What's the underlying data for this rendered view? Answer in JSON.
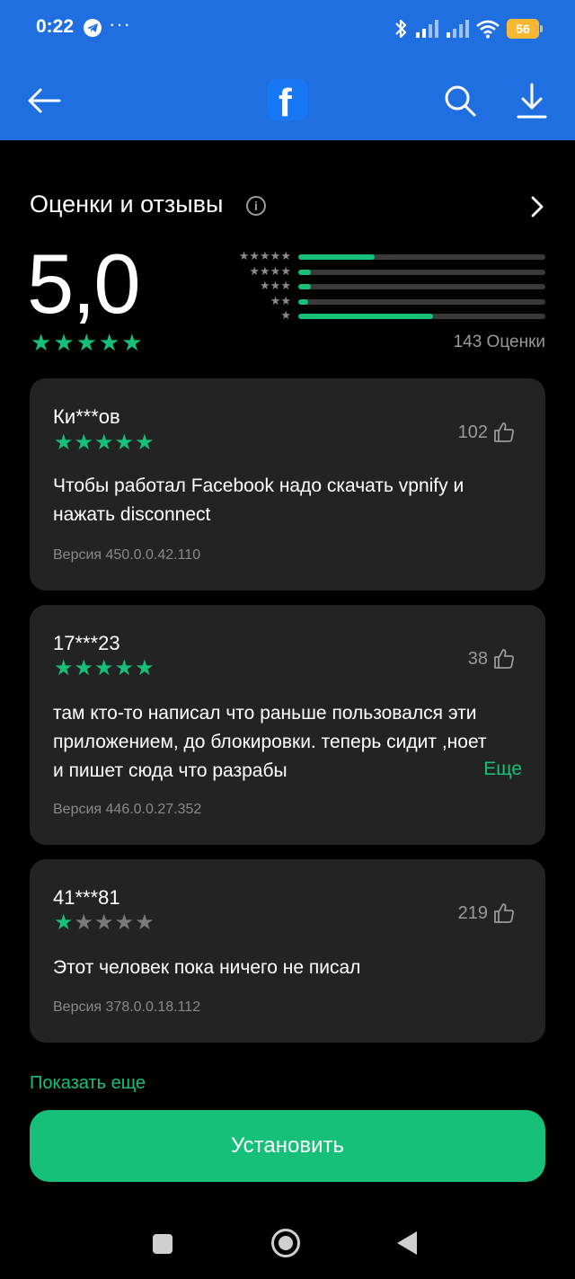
{
  "status_bar": {
    "time": "0:22",
    "more": "···",
    "battery": "56",
    "icons": [
      "telegram-icon",
      "bluetooth-icon",
      "signal-icon",
      "signal-icon",
      "wifi-icon",
      "battery-icon"
    ]
  },
  "app_bar": {
    "logo_letter": "f",
    "icons": [
      "back-arrow-icon",
      "facebook-logo",
      "search-icon",
      "download-icon"
    ],
    "colors": {
      "background": "#1f6fe0",
      "logo": "#1877f2"
    }
  },
  "ratings": {
    "title": "Оценки и отзывы",
    "info_symbol": "i",
    "score": "5,0",
    "stars": 5,
    "count_label": "143 Оценки",
    "distribution": [
      {
        "stars": 5,
        "fraction": 0.31
      },
      {
        "stars": 4,
        "fraction": 0.05
      },
      {
        "stars": 3,
        "fraction": 0.05
      },
      {
        "stars": 2,
        "fraction": 0.04
      },
      {
        "stars": 1,
        "fraction": 0.545
      }
    ]
  },
  "reviews": [
    {
      "author": "Ки***ов",
      "rating": 5,
      "likes": "102",
      "text": "Чтобы работал Facebook надо скачать vpnify и нажать disconnect",
      "version": "Версия 450.0.0.42.110"
    },
    {
      "author": "17***23",
      "rating": 5,
      "likes": "38",
      "text": "там кто-то написал что  раньше пользовался эти приложением, до блокировки. теперь сидит ,ноет и пишет сюда что разрабы",
      "more_label": "Еще",
      "version": "Версия 446.0.0.27.352"
    },
    {
      "author": "41***81",
      "rating": 1,
      "likes": "219",
      "text": "Этот человек пока ничего не писал",
      "version": "Версия 378.0.0.18.112"
    }
  ],
  "show_more_label": "Показать еще",
  "install_label": "Установить",
  "colors": {
    "accent": "#16c079",
    "card": "#232323",
    "background": "#000000"
  }
}
